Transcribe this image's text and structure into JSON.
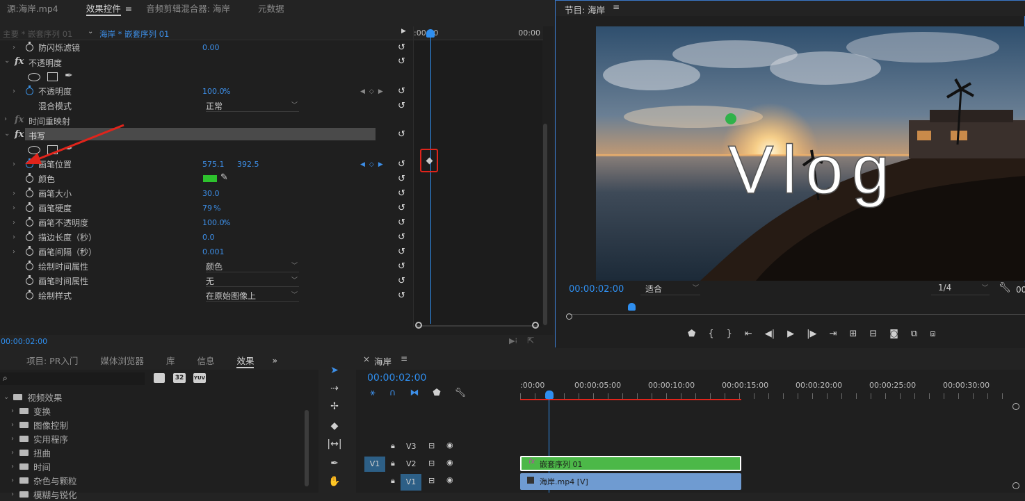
{
  "topTabs": {
    "source": "源:海岸.mp4",
    "effectControls": "效果控件",
    "audioMixer": "音频剪辑混合器: 海岸",
    "metadata": "元数据"
  },
  "program": {
    "title": "节目: 海岸"
  },
  "ec": {
    "masterClip": "主要 * 嵌套序列 01",
    "seqClip": "海岸 * 嵌套序列 01",
    "tlStart": ":00:00",
    "tlEnd": "00:00",
    "currentTime": "00:00:02:00",
    "antiFlicker": {
      "label": "防闪烁滤镜",
      "value": "0.00"
    },
    "opacityHeader": "不透明度",
    "opacity": {
      "label": "不透明度",
      "value": "100.0",
      "unit": "%"
    },
    "blendMode": {
      "label": "混合模式",
      "value": "正常"
    },
    "timeRemap": "时间重映射",
    "writeOn": "书写",
    "brushPos": {
      "label": "画笔位置",
      "x": "575.1",
      "y": "392.5"
    },
    "color": {
      "label": "颜色",
      "swatch": "#2dc12d"
    },
    "brushSize": {
      "label": "画笔大小",
      "value": "30.0"
    },
    "brushHardness": {
      "label": "画笔硬度",
      "value": "79",
      "unit": "%"
    },
    "brushOpacity": {
      "label": "画笔不透明度",
      "value": "100.0",
      "unit": "%"
    },
    "strokeLength": {
      "label": "描边长度（秒）",
      "value": "0.0"
    },
    "brushSpacing": {
      "label": "画笔间隔（秒）",
      "value": "0.001"
    },
    "paintTimeProps": {
      "label": "绘制时间属性",
      "value": "颜色"
    },
    "brushTimeProps": {
      "label": "画笔时间属性",
      "value": "无"
    },
    "paintStyle": {
      "label": "绘制样式",
      "value": "在原始图像上"
    }
  },
  "monitor": {
    "overlayText": "Vlog",
    "time": "00:00:02:00",
    "fit": "适合",
    "resolution": "1/4",
    "timeCut": "00"
  },
  "project": {
    "tabs": [
      "项目: PR入门",
      "媒体浏览器",
      "库",
      "信息",
      "效果"
    ],
    "more": "»",
    "tree": [
      {
        "label": "视频效果",
        "level": 0,
        "open": true
      },
      {
        "label": "变换",
        "level": 1
      },
      {
        "label": "图像控制",
        "level": 1
      },
      {
        "label": "实用程序",
        "level": 1
      },
      {
        "label": "扭曲",
        "level": 1
      },
      {
        "label": "时间",
        "level": 1
      },
      {
        "label": "杂色与颗粒",
        "level": 1
      },
      {
        "label": "模糊与锐化",
        "level": 1
      }
    ],
    "badges": [
      "32",
      "YUV"
    ]
  },
  "timeline": {
    "close": "×",
    "seqName": "海岸",
    "time": "00:00:02:00",
    "ruler": [
      ":00:00",
      "00:00:05:00",
      "00:00:10:00",
      "00:00:15:00",
      "00:00:20:00",
      "00:00:25:00",
      "00:00:30:00"
    ],
    "tracks": [
      {
        "name": "V3",
        "target": ""
      },
      {
        "name": "V2",
        "target": "V1"
      },
      {
        "name": "V1",
        "target": ""
      }
    ],
    "clipNested": "嵌套序列 01",
    "clipVideo": "海岸.mp4 [V]"
  }
}
